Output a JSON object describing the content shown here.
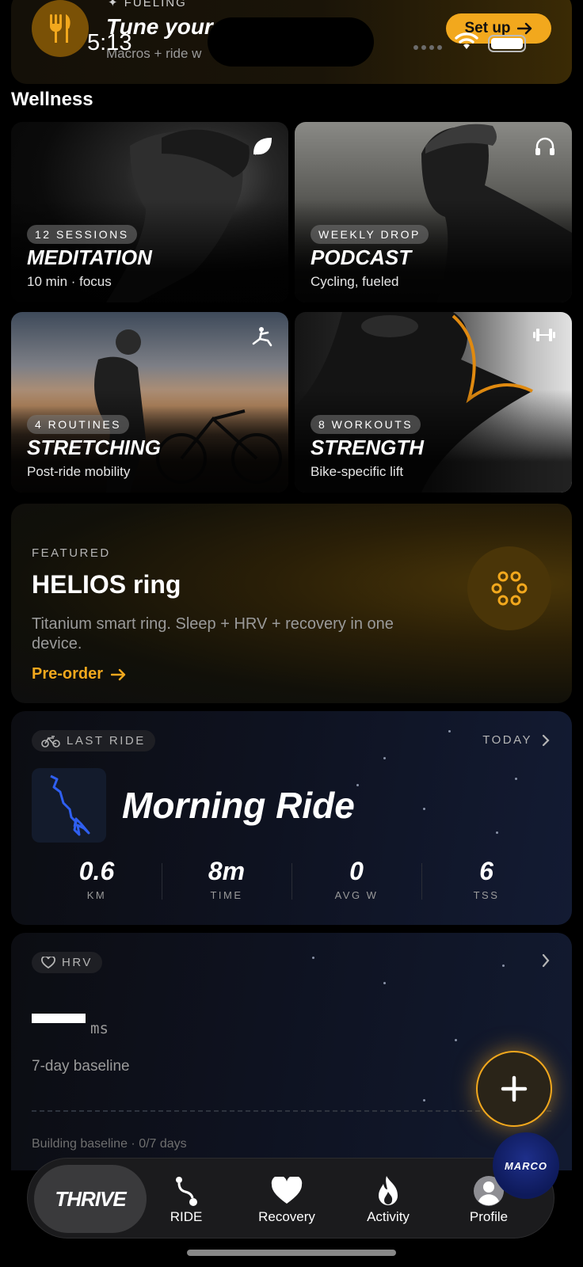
{
  "status_bar": {
    "time": "5:13"
  },
  "fueling": {
    "kicker": "FUELING",
    "title": "Tune your",
    "subtitle": "Macros + ride w",
    "button_label": "Set up",
    "icon": "fork-knife-icon"
  },
  "wellness": {
    "title": "Wellness",
    "tiles": [
      {
        "badge": "12 SESSIONS",
        "title": "MEDITATION",
        "subtitle": "10 min · focus",
        "icon": "leaf-icon"
      },
      {
        "badge": "WEEKLY DROP",
        "title": "PODCAST",
        "subtitle": "Cycling, fueled",
        "icon": "headphones-icon"
      },
      {
        "badge": "4 ROUTINES",
        "title": "STRETCHING",
        "subtitle": "Post-ride mobility",
        "icon": "stretch-icon"
      },
      {
        "badge": "8 WORKOUTS",
        "title": "STRENGTH",
        "subtitle": "Bike-specific lift",
        "icon": "dumbbell-icon"
      }
    ]
  },
  "featured": {
    "kicker": "FEATURED",
    "title": "HELIOS ring",
    "description": "Titanium smart ring. Sleep + HRV + recovery in one device.",
    "cta": "Pre-order",
    "accent": "#F2A81D"
  },
  "last_ride": {
    "label": "LAST RIDE",
    "when": "TODAY",
    "name": "Morning Ride",
    "stats": [
      {
        "value": "0.6",
        "label": "KM"
      },
      {
        "value": "8m",
        "label": "TIME"
      },
      {
        "value": "0",
        "label": "AVG W"
      },
      {
        "value": "6",
        "label": "TSS"
      }
    ]
  },
  "hrv": {
    "label": "HRV",
    "unit": "ms",
    "baseline_label": "7-day baseline",
    "status": "Building baseline · 0/7 days"
  },
  "coach": {
    "label": "MARCO"
  },
  "tabbar": {
    "active": "THRIVE",
    "tabs": [
      {
        "label": "RIDE",
        "icon": "route-icon"
      },
      {
        "label": "Recovery",
        "icon": "heart-icon"
      },
      {
        "label": "Activity",
        "icon": "flame-icon"
      },
      {
        "label": "Profile",
        "icon": "person-icon"
      }
    ]
  }
}
